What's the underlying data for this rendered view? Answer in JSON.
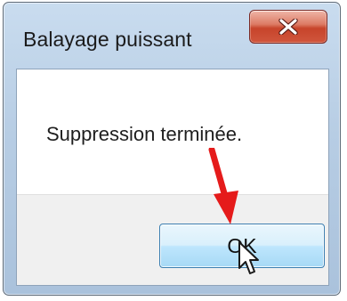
{
  "dialog": {
    "title": "Balayage puissant",
    "close_icon": "close-x-icon",
    "message": "Suppression terminée.",
    "ok_label": "OK"
  },
  "overlay": {
    "arrow_icon": "red-arrow-icon",
    "cursor_icon": "hand-pointer-cursor-icon"
  },
  "colors": {
    "titlebar": "#b7cde4",
    "close_button": "#c7442b",
    "ok_button": "#bee6fd",
    "arrow": "#e51b1b"
  }
}
